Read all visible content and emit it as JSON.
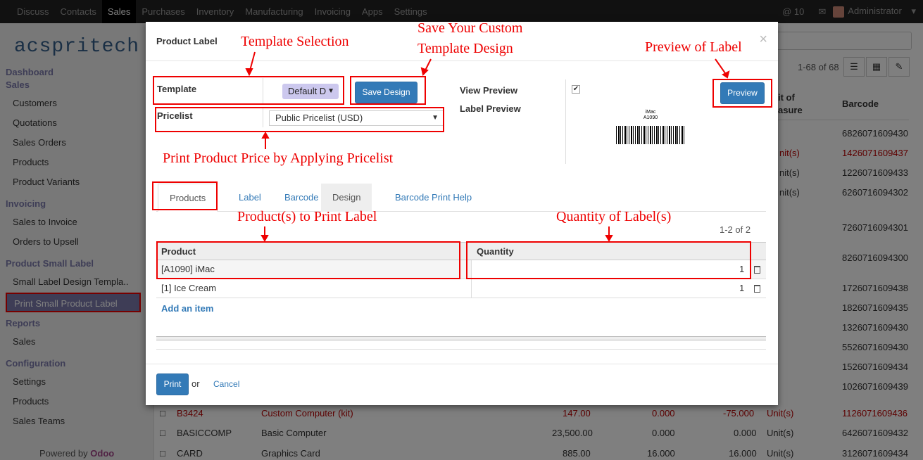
{
  "topbar": {
    "menu": [
      "Discuss",
      "Contacts",
      "Sales",
      "Purchases",
      "Inventory",
      "Manufacturing",
      "Invoicing",
      "Apps",
      "Settings"
    ],
    "active": "Sales",
    "notifications": "10",
    "user": "Administrator"
  },
  "sidebar": {
    "logo": "acspritech",
    "sections": [
      {
        "title": "Dashboard",
        "items": []
      },
      {
        "title": "Sales",
        "items": [
          "Customers",
          "Quotations",
          "Sales Orders",
          "Products",
          "Product Variants"
        ]
      },
      {
        "title": "Invoicing",
        "items": [
          "Sales to Invoice",
          "Orders to Upsell"
        ]
      },
      {
        "title": "Product Small Label",
        "items": [
          "Small Label Design Templa..",
          "Print Small Product Label"
        ]
      },
      {
        "title": "Reports",
        "items": [
          "Sales"
        ]
      },
      {
        "title": "Configuration",
        "items": [
          "Settings",
          "Products",
          "Sales Teams"
        ]
      }
    ],
    "powered_prefix": "Powered by",
    "powered_brand": "Odoo"
  },
  "content": {
    "pager": "1-68 of 68",
    "col_uom_1": "it of",
    "col_uom_2": "asure",
    "col_barcode": "Barcode",
    "barcodes": [
      "6826071609430",
      "1426071609437",
      "1226071609433",
      "6260716094302",
      "7260716094301",
      "8260716094300",
      "1726071609438",
      "1826071609435",
      "1326071609430",
      "5526071609430",
      "1526071609434",
      "1026071609439"
    ],
    "rows": [
      {
        "ref": "B3424",
        "name": "Custom Computer (kit)",
        "price": "147.00",
        "a": "0.000",
        "b": "-75.000",
        "uom": "Unit(s)",
        "barcode": "1126071609436"
      },
      {
        "ref": "BASICCOMP",
        "name": "Basic Computer",
        "price": "23,500.00",
        "a": "0.000",
        "b": "0.000",
        "uom": "Unit(s)",
        "barcode": "6426071609432"
      },
      {
        "ref": "CARD",
        "name": "Graphics Card",
        "price": "885.00",
        "a": "16.000",
        "b": "16.000",
        "uom": "Unit(s)",
        "barcode": "3126071609434"
      }
    ]
  },
  "modal": {
    "title": "Product Label",
    "close": "×",
    "template_label": "Template",
    "template_value": "Default D",
    "pricelist_label": "Pricelist",
    "pricelist_value": "Public Pricelist (USD)",
    "save_design": "Save Design",
    "view_preview": "View Preview",
    "label_preview": "Label Preview",
    "preview_btn": "Preview",
    "preview_name": "iMac",
    "preview_code": "A1090",
    "tabs": [
      "Products",
      "Label",
      "Barcode",
      "Design",
      "Barcode Print Help"
    ],
    "pager": "1-2 of 2",
    "col_product": "Product",
    "col_quantity": "Quantity",
    "lines": [
      {
        "product": "[A1090] iMac",
        "qty": "1"
      },
      {
        "product": "[1] Ice Cream",
        "qty": "1"
      }
    ],
    "add_item": "Add an item",
    "print": "Print",
    "or": "or",
    "cancel": "Cancel"
  },
  "annotations": {
    "template_selection": "Template Selection",
    "save_custom_1": "Save Your Custom",
    "save_custom_2": "Template Design",
    "preview_of_label": "Preview of Label",
    "print_price": "Print Product Price by Applying Pricelist",
    "products_to_print": "Product(s) to Print Label",
    "quantity_of_labels": "Quantity of Label(s)"
  }
}
